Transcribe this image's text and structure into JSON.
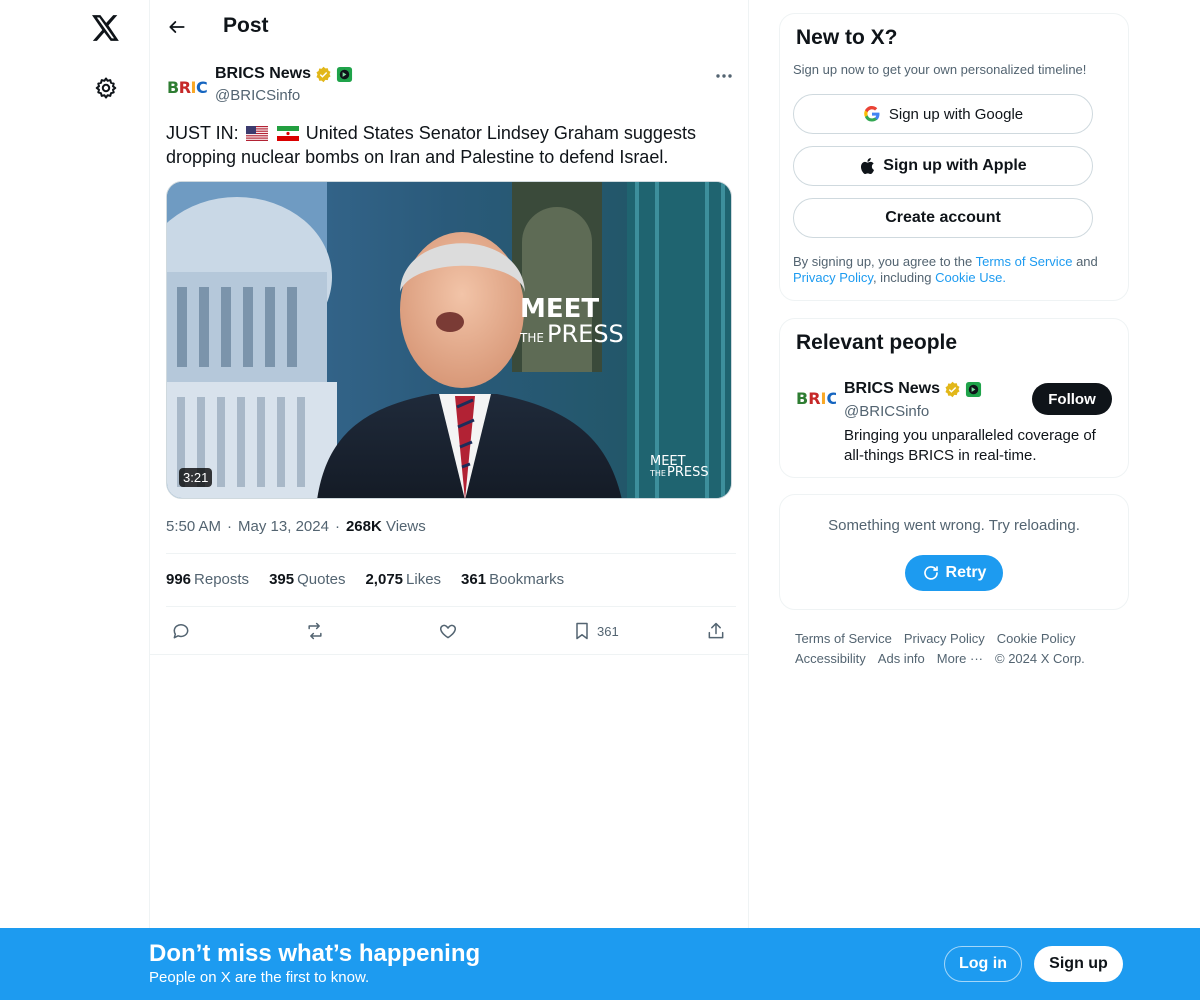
{
  "nav": {
    "logo_icon": "x-logo-icon",
    "settings_icon": "gear-icon"
  },
  "header": {
    "title": "Post",
    "back_icon": "arrow-left-icon"
  },
  "post": {
    "author_name": "BRICS News",
    "author_handle": "@BRICSinfo",
    "avatar_text": "BRICS",
    "text_prefix": "JUST IN:",
    "text_body": "United States Senator Lindsey Graham suggests dropping nuclear bombs on Iran and Palestine to defend Israel.",
    "flags": [
      "us-flag-icon",
      "iran-flag-icon"
    ],
    "video_duration": "3:21",
    "video_logo_main": "MEET THE PRESS",
    "time": "5:50 AM",
    "date": "May 13, 2024",
    "views_count": "268K",
    "views_label": "Views",
    "stats": [
      {
        "count": "996",
        "label": "Reposts"
      },
      {
        "count": "395",
        "label": "Quotes"
      },
      {
        "count": "2,075",
        "label": "Likes"
      },
      {
        "count": "361",
        "label": "Bookmarks"
      }
    ],
    "bookmark_count": "361"
  },
  "signup_card": {
    "title": "New to X?",
    "subtitle": "Sign up now to get your own personalized timeline!",
    "google_label": "Sign up with Google",
    "apple_label": "Sign up with Apple",
    "create_label": "Create account",
    "legal_1": "By signing up, you agree to the",
    "tos": "Terms of Service",
    "and": "and",
    "privacy": "Privacy Policy",
    "including": ", including",
    "cookie": "Cookie Use."
  },
  "relevant": {
    "title": "Relevant people",
    "name": "BRICS News",
    "handle": "@BRICSinfo",
    "bio": "Bringing you unparalleled coverage of all-things BRICS in real-time.",
    "follow_label": "Follow"
  },
  "error_card": {
    "message": "Something went wrong. Try reloading.",
    "retry_label": "Retry"
  },
  "footer": {
    "links": [
      "Terms of Service",
      "Privacy Policy",
      "Cookie Policy",
      "Accessibility",
      "Ads info",
      "More ···"
    ],
    "copyright": "© 2024 X Corp."
  },
  "bottom_bar": {
    "title": "Don’t miss what’s happening",
    "subtitle": "People on X are the first to know.",
    "login_label": "Log in",
    "signup_label": "Sign up"
  },
  "colors": {
    "accent": "#1d9bf0",
    "text": "#0f1419",
    "muted": "#536471",
    "verified": "#e2b719"
  }
}
